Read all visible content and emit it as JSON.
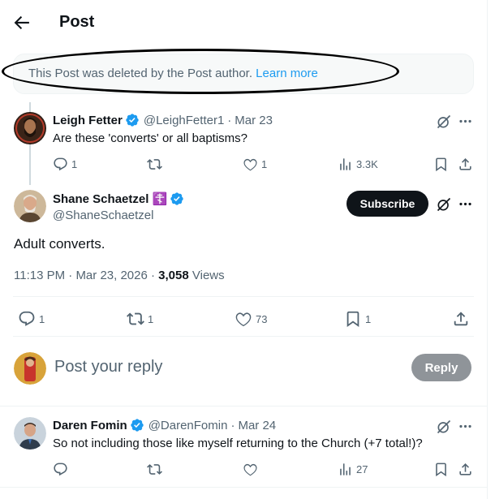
{
  "header": {
    "title": "Post"
  },
  "deleted_notice": {
    "text": "This Post was deleted by the Post author.",
    "link": "Learn more"
  },
  "reply_1": {
    "name": "Leigh Fetter",
    "handle": "@LeighFetter1",
    "separator": "·",
    "date": "Mar 23",
    "text": "Are these 'converts' or all baptisms?",
    "replies": "1",
    "likes": "1",
    "views": "3.3K"
  },
  "main_post": {
    "name": "Shane Schaetzel ☦️",
    "handle": "@ShaneSchaetzel",
    "subscribe_label": "Subscribe",
    "text": "Adult converts.",
    "time": "11:13 PM",
    "separator": "·",
    "date": "Mar 23, 2026",
    "views_count": "3,058",
    "views_label": "Views",
    "replies": "1",
    "reposts": "1",
    "likes": "73",
    "bookmarks": "1"
  },
  "reply_box": {
    "placeholder": "Post your reply",
    "button": "Reply"
  },
  "reply_2": {
    "name": "Daren Fomin",
    "handle": "@DarenFomin",
    "separator": "·",
    "date": "Mar 24",
    "text": "So not including those like myself returning to the Church (+7 total!)?",
    "views": "27"
  },
  "colors": {
    "accent": "#1d9bf0",
    "text": "#0f1419",
    "muted": "#536471",
    "divider": "#eff3f4"
  },
  "icons": [
    "back-arrow-icon",
    "verified-badge-icon",
    "grok-icon",
    "more-icon",
    "reply-icon",
    "repost-icon",
    "like-icon",
    "views-icon",
    "bookmark-icon",
    "share-icon"
  ]
}
